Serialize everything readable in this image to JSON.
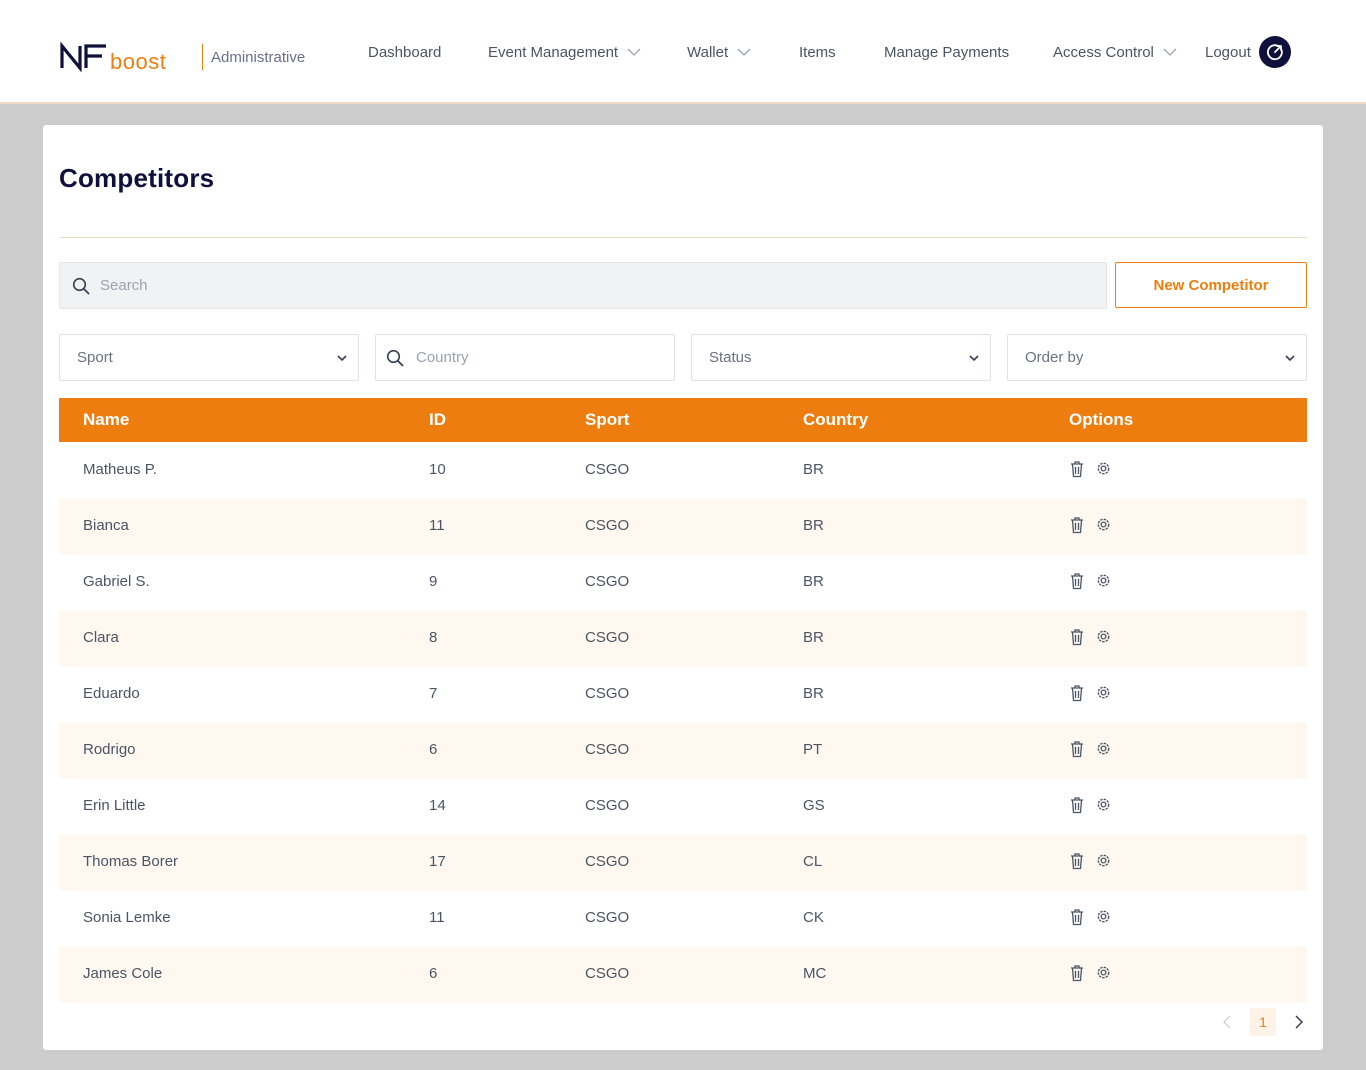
{
  "brand": {
    "logo_text": "NFboost",
    "subtitle": "Administrative"
  },
  "nav": {
    "items": [
      {
        "label": "Dashboard",
        "has_dropdown": false
      },
      {
        "label": "Event Management",
        "has_dropdown": true
      },
      {
        "label": "Wallet",
        "has_dropdown": true
      },
      {
        "label": "Items",
        "has_dropdown": false
      },
      {
        "label": "Manage Payments",
        "has_dropdown": false
      },
      {
        "label": "Access Control",
        "has_dropdown": true
      }
    ],
    "logout_label": "Logout",
    "logout_icon": "power-icon"
  },
  "page": {
    "title": "Competitors"
  },
  "search": {
    "placeholder": "Search",
    "value": ""
  },
  "actions": {
    "new_label": "New Competitor"
  },
  "filters": {
    "sport": "Sport",
    "country_placeholder": "Country",
    "status": "Status",
    "order_by": "Order by"
  },
  "table": {
    "headers": {
      "name": "Name",
      "id": "ID",
      "sport": "Sport",
      "country": "Country",
      "options": "Options"
    },
    "rows": [
      {
        "name": "Matheus P.",
        "id": "10",
        "sport": "CSGO",
        "country": "BR"
      },
      {
        "name": "Bianca",
        "id": "11",
        "sport": "CSGO",
        "country": "BR"
      },
      {
        "name": "Gabriel S.",
        "id": "9",
        "sport": "CSGO",
        "country": "BR"
      },
      {
        "name": "Clara",
        "id": "8",
        "sport": "CSGO",
        "country": "BR"
      },
      {
        "name": "Eduardo",
        "id": "7",
        "sport": "CSGO",
        "country": "BR"
      },
      {
        "name": "Rodrigo",
        "id": "6",
        "sport": "CSGO",
        "country": "PT"
      },
      {
        "name": "Erin Little",
        "id": "14",
        "sport": "CSGO",
        "country": "GS"
      },
      {
        "name": "Thomas Borer",
        "id": "17",
        "sport": "CSGO",
        "country": "CL"
      },
      {
        "name": "Sonia Lemke",
        "id": "11",
        "sport": "CSGO",
        "country": "CK"
      },
      {
        "name": "James Cole",
        "id": "6",
        "sport": "CSGO",
        "country": "MC"
      }
    ],
    "option_icons": [
      "trash-icon",
      "gear-icon"
    ]
  },
  "pagination": {
    "current_page": "1"
  },
  "colors": {
    "accent": "#ee7d10",
    "navy": "#10103c",
    "row_alt": "#fef8f1",
    "page_bg": "#cccccc"
  }
}
